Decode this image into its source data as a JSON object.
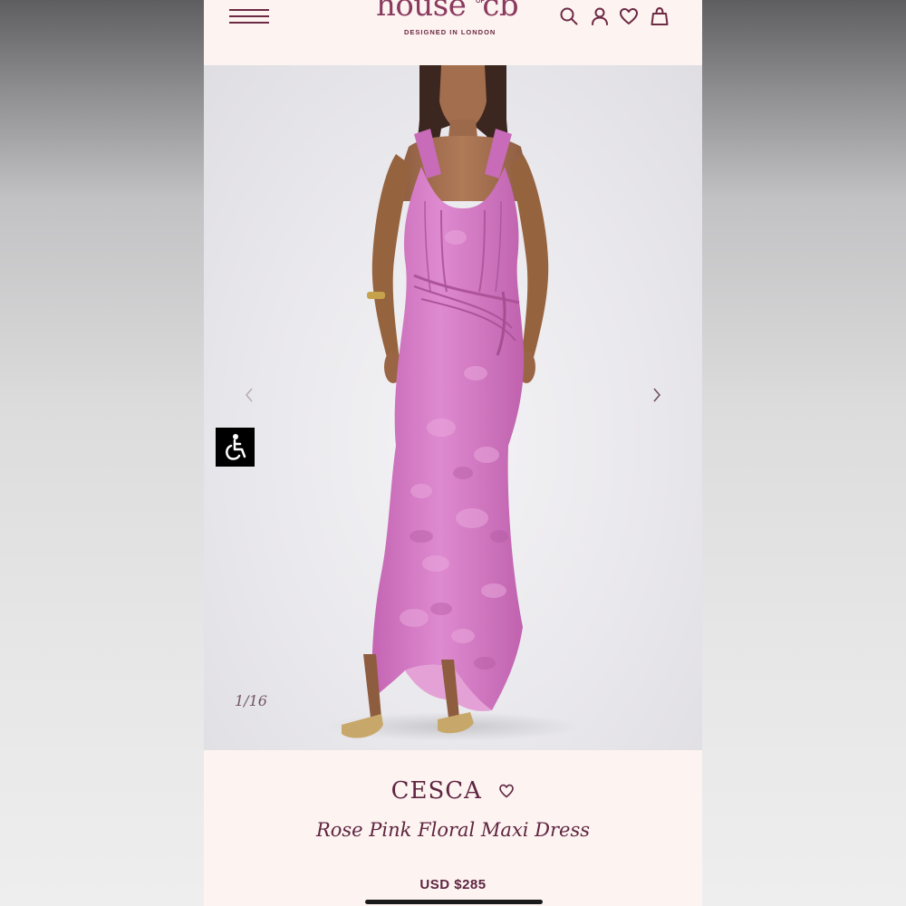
{
  "header": {
    "menu_icon": "hamburger-menu-icon",
    "logo_text": "house",
    "logo_of": "OF",
    "logo_initials": "cb",
    "logo_tagline": "DESIGNED IN LONDON",
    "icons": [
      "search-icon",
      "account-icon",
      "wishlist-heart-icon",
      "shopping-bag-icon"
    ]
  },
  "gallery": {
    "counter": "1/16",
    "prev_icon": "chevron-left-icon",
    "next_icon": "chevron-right-icon",
    "accessibility_icon": "accessibility-icon"
  },
  "product": {
    "name": "CESCA",
    "description": "Rose Pink Floral Maxi Dress",
    "price": "USD $285"
  },
  "colors": {
    "brand": "#8a3a5e",
    "text": "#5e2540",
    "page_background": "#fdf3f1",
    "dress": "#d47cc4"
  }
}
